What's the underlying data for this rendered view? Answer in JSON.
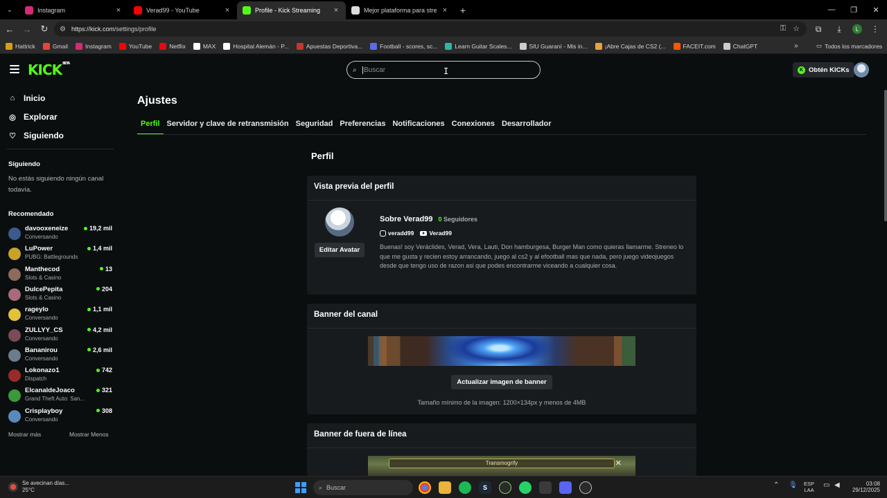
{
  "browser": {
    "tabs": [
      {
        "title": "Instagram",
        "icon": "instagram-icon",
        "color": "#d62976",
        "active": false
      },
      {
        "title": "Verad99 - YouTube",
        "icon": "youtube-icon",
        "color": "#ff0000",
        "active": false
      },
      {
        "title": "Profile - Kick Streaming",
        "icon": "kick-icon",
        "color": "#53fc18",
        "active": true
      },
      {
        "title": "Mejor plataforma para stream",
        "icon": "globe-icon",
        "color": "#dddddd",
        "active": false
      }
    ],
    "url_host": "https://kick.com",
    "url_path": "/settings/profile",
    "profile_initial": "L",
    "bookmarks": [
      {
        "label": "Hattrick",
        "color": "#d4a017"
      },
      {
        "label": "Gmail",
        "color": "#ea4335"
      },
      {
        "label": "Instagram",
        "color": "#d62976"
      },
      {
        "label": "YouTube",
        "color": "#ff0000"
      },
      {
        "label": "Netflix",
        "color": "#e50914"
      },
      {
        "label": "MAX",
        "color": "#ffffff"
      },
      {
        "label": "Hospital Alemán - P...",
        "color": "#ffffff"
      },
      {
        "label": "Apuestas Deportiva...",
        "color": "#c0392b"
      },
      {
        "label": "Football - scores, sc...",
        "color": "#5b6ee1"
      },
      {
        "label": "Learn Guitar Scales...",
        "color": "#2ab7a9"
      },
      {
        "label": "SIU Guaraní - Mis in...",
        "color": "#cccccc"
      },
      {
        "label": "¡Abre Cajas de CS2 (...",
        "color": "#e8a33d"
      },
      {
        "label": "FACEIT.com",
        "color": "#ff5500"
      },
      {
        "label": "ChatGPT",
        "color": "#cccccc"
      }
    ],
    "bookmarks_all": "Todos los marcadores"
  },
  "header": {
    "logo": "KICK",
    "search_placeholder": "Buscar",
    "get_kicks": "Obtén KICKs"
  },
  "sidebar": {
    "nav": [
      {
        "label": "Inicio",
        "icon": "home-icon"
      },
      {
        "label": "Explorar",
        "icon": "compass-icon"
      },
      {
        "label": "Siguiendo",
        "icon": "heart-icon"
      }
    ],
    "following_title": "Siguiendo",
    "following_empty": "No estás siguiendo ningún canal todavía.",
    "recommended_title": "Recomendado",
    "channels": [
      {
        "name": "davooxeneize",
        "category": "Conversando",
        "viewers": "19,2 mil",
        "color": "#3b5b8c"
      },
      {
        "name": "LuPower",
        "category": "PUBG: Battlegrounds",
        "viewers": "1,4 mil",
        "color": "#c9a227"
      },
      {
        "name": "Manthecod",
        "category": "Slots & Casino",
        "viewers": "13",
        "color": "#8b6b5a"
      },
      {
        "name": "DulcePepita",
        "category": "Slots & Casino",
        "viewers": "204",
        "color": "#a86b7c"
      },
      {
        "name": "rageylo",
        "category": "Conversando",
        "viewers": "1,1 mil",
        "color": "#e2c13b"
      },
      {
        "name": "ZULLYY_CS",
        "category": "Conversando",
        "viewers": "4,2 mil",
        "color": "#7a4a5a"
      },
      {
        "name": "Bananirou",
        "category": "Conversando",
        "viewers": "2,6 mil",
        "color": "#6b7c8c"
      },
      {
        "name": "Lokonazo1",
        "category": "Dispatch",
        "viewers": "742",
        "color": "#9a2a2a"
      },
      {
        "name": "ElcanaldeJoaco",
        "category": "Grand Theft Auto: San...",
        "viewers": "321",
        "color": "#3a9a3a"
      },
      {
        "name": "Crisplayboy",
        "category": "Conversando",
        "viewers": "308",
        "color": "#5a8aba"
      }
    ],
    "show_more": "Mostrar más",
    "show_less": "Mostrar Menos"
  },
  "main": {
    "title": "Ajustes",
    "tabs": [
      "Perfil",
      "Servidor y clave de retransmisión",
      "Seguridad",
      "Preferencias",
      "Notificaciones",
      "Conexiones",
      "Desarrollador"
    ],
    "section_title": "Perfil",
    "preview": {
      "title": "Vista previa del perfil",
      "edit_avatar": "Editar Avatar",
      "about": "Sobre Verad99",
      "followers_count": "0",
      "followers_label": "Seguidores",
      "instagram": "veradd99",
      "youtube": "Verad99",
      "bio": "Buenas! soy Veráclides, Verad, Vera, Lauti, Don hamburgesa, Burger Man como quieras llamarme. Streneo lo que me gusta y recien estoy arrancando, juego al cs2 y al efootball mas que nada, pero juego videojuegos desde que tengo uso de razon asi que podes encontrarme viceando a cualquier cosa."
    },
    "banner": {
      "title": "Banner del canal",
      "update_button": "Actualizar imagen de banner",
      "note": "Tamaño mínimo de la imagen: 1200×134px y menos de 4MB"
    },
    "offline_banner": {
      "title": "Banner de fuera de línea",
      "image_text": "Transmogrify"
    }
  },
  "taskbar": {
    "weather_text": "Se avecinan días...",
    "temperature": "25°C",
    "search_placeholder": "Buscar",
    "lang_1": "ESP",
    "lang_2": "LAA",
    "time": "03:08",
    "date": "29/12/2025"
  }
}
